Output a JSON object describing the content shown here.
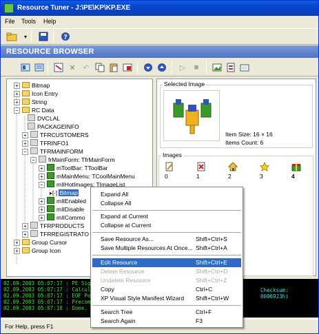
{
  "window": {
    "title": "Resource Tuner - J:\\PE\\KP\\KP.EXE"
  },
  "menubar": {
    "items": [
      "File",
      "Tools",
      "Help"
    ]
  },
  "banner": {
    "title": "RESOURCE BROWSER"
  },
  "tree": {
    "items": [
      {
        "label": "Bitmap"
      },
      {
        "label": "Icon Entry"
      },
      {
        "label": "String"
      },
      {
        "label": "RC Data"
      },
      {
        "label": "DVCLAL"
      },
      {
        "label": "PACKAGEINFO"
      },
      {
        "label": "TFRCUSTOMERS"
      },
      {
        "label": "TFRINFO1"
      },
      {
        "label": "TFRMAINFORM"
      },
      {
        "label": "frMainForm: TfrMainForm"
      },
      {
        "label": "mToolBar: TToolBar"
      },
      {
        "label": "mMainMenu: TCoolMainMenu"
      },
      {
        "label": "mIIHotImages: TImageList"
      },
      {
        "label": "Bitmap"
      },
      {
        "label": "mIIEnabled"
      },
      {
        "label": "mIIDisable"
      },
      {
        "label": "mIICommo"
      },
      {
        "label": "TFRPRODUCTS"
      },
      {
        "label": "TFRREGISTRATO"
      },
      {
        "label": "Group Cursor"
      },
      {
        "label": "Group Icon"
      }
    ]
  },
  "preview": {
    "selected_label": "Selected Image",
    "item_size": "Item Size: 16 × 16",
    "items_count": "Items Count: 6",
    "images_label": "Images",
    "images": [
      {
        "index": "0",
        "icon": "pencil-icon"
      },
      {
        "index": "1",
        "icon": "red-x-doc-icon"
      },
      {
        "index": "2",
        "icon": "home-icon"
      },
      {
        "index": "3",
        "icon": "star-icon"
      },
      {
        "index": "4",
        "icon": "gift-icon"
      }
    ]
  },
  "log": {
    "lines": [
      "02.09.2003 05:07:17 : PE Signat",
      "02.09.2003 05:07:17 : Calculat",
      "02.09.2003 05:07:17 : EOF Posit",
      "02.09.2003 05:07:17 : Precompil",
      "02.09.2003 05:07:18 : Done."
    ],
    "checksum": "Checksum: 0006923h)"
  },
  "status": {
    "text": "For Help, press F1"
  },
  "context_menu": {
    "items": [
      {
        "label": "Expand All",
        "shortcut": ""
      },
      {
        "label": "Collapse All",
        "shortcut": ""
      },
      {
        "label": "Expand at Current",
        "shortcut": ""
      },
      {
        "label": "Collapse at Current",
        "shortcut": ""
      },
      {
        "label": "Save Resource As...",
        "shortcut": "Shift+Ctrl+S"
      },
      {
        "label": "Save Multiple Resources At Once...",
        "shortcut": "Shift+Ctrl+A"
      },
      {
        "label": "Edit Resource",
        "shortcut": "Shift+Ctrl+E"
      },
      {
        "label": "Delete Resource",
        "shortcut": "Shift+Ctrl+D"
      },
      {
        "label": "Undelete Resource",
        "shortcut": "Shift+Ctrl+Z"
      },
      {
        "label": "Copy",
        "shortcut": "Ctrl+C"
      },
      {
        "label": "XP Visual Style Manifest Wizard",
        "shortcut": "Shift+Ctrl+W"
      },
      {
        "label": "Search Tree",
        "shortcut": "Ctrl+F"
      },
      {
        "label": "Search Again",
        "shortcut": "F3"
      }
    ]
  },
  "colors": {
    "titlebar": "#0846c8",
    "banner": "#5a7fd0",
    "selection": "#316ac5",
    "log_text": "#3ee02b"
  }
}
